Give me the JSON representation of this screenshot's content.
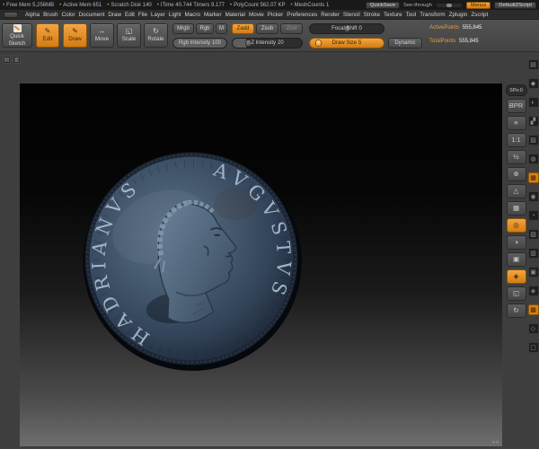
{
  "statusbar": {
    "stats": [
      "Free Mem 5,256MB",
      "Active Mem 651",
      "Scratch Disk 140",
      "ITime 40.744  Timers 9.177",
      "PolyCount 562.07 KP",
      "MeshCounts 1"
    ],
    "quicksave": "QuickSave",
    "see_through": "See-through",
    "menus": "Menus",
    "zscript": "DefaultZScript"
  },
  "menubar": {
    "items": [
      "Alpha",
      "Brush",
      "Color",
      "Document",
      "Draw",
      "Edit",
      "File",
      "Layer",
      "Light",
      "Macro",
      "Marker",
      "Material",
      "Movie",
      "Picker",
      "Preferences",
      "Render",
      "Stencil",
      "Stroke",
      "Texture",
      "Tool",
      "Transform",
      "Zplugin",
      "Zscript"
    ]
  },
  "shelf": {
    "quick_sketch": "Quick Sketch",
    "edit": "Edit",
    "draw": "Draw",
    "move": "Move",
    "scale": "Scale",
    "rotate": "Rotate",
    "icons": {
      "edit": "✎",
      "draw": "✎",
      "move": "↔",
      "scale": "◱",
      "rotate": "↻"
    },
    "mrgb": "Mrgb",
    "rgb": "Rgb",
    "m": "M",
    "zadd": "Zadd",
    "zsub": "Zsub",
    "zcut": "Zcut",
    "rgb_intensity": {
      "label": "Rgb Intensity",
      "value": "100"
    },
    "z_intensity": {
      "label": "Z Intensity",
      "value": "20"
    },
    "focal_shift": {
      "label": "Focal Shift",
      "value": "0"
    },
    "draw_size": {
      "label": "Draw Size",
      "value": "5"
    },
    "dynamic": "Dynamic",
    "active_points": {
      "label": "ActivePoints",
      "value": "555,845"
    },
    "total_points": {
      "label": "TotalPoints",
      "value": "555,845"
    }
  },
  "right_shelf": {
    "spix": {
      "label": "SPix",
      "value": "0"
    },
    "buttons": [
      {
        "name": "bpr-button",
        "glyph": "BPR"
      },
      {
        "name": "scroll-button",
        "glyph": "≡"
      },
      {
        "name": "actual-size-button",
        "glyph": "1:1"
      },
      {
        "name": "aahalf-button",
        "glyph": "½"
      },
      {
        "name": "zoom-button",
        "glyph": "⊕"
      },
      {
        "name": "persp-button",
        "glyph": "△"
      },
      {
        "name": "floor-button",
        "glyph": "▦"
      },
      {
        "name": "local-button",
        "glyph": "◎",
        "accent": true
      },
      {
        "name": "lsym-button",
        "glyph": "◑"
      },
      {
        "name": "frame-button",
        "glyph": "▣"
      },
      {
        "name": "move-3d-button",
        "glyph": "◈",
        "accent": true
      },
      {
        "name": "scale-3d-button",
        "glyph": "◱"
      },
      {
        "name": "rotate-3d-button",
        "glyph": "↻"
      }
    ]
  },
  "right_tray": {
    "icons": [
      {
        "glyph": "▤"
      },
      {
        "glyph": "◆"
      },
      {
        "glyph": "◐"
      },
      {
        "glyph": "▞"
      },
      {
        "glyph": "▨"
      },
      {
        "glyph": "◍"
      },
      {
        "glyph": "▦",
        "accent": true
      },
      {
        "glyph": "◉"
      },
      {
        "glyph": "◔"
      },
      {
        "glyph": "▧"
      },
      {
        "glyph": "▥"
      },
      {
        "glyph": "▣"
      },
      {
        "glyph": "◈"
      },
      {
        "glyph": "▩",
        "accent": true
      },
      {
        "glyph": "◇"
      },
      {
        "glyph": "▢"
      }
    ]
  },
  "left_tray": {
    "icons": [
      {
        "glyph": "▤"
      },
      {
        "glyph": "▥"
      }
    ]
  },
  "canvas": {
    "coin": {
      "legend_left": "HADRIANVS",
      "legend_right": "AVGVSTVS"
    },
    "nav": {
      "left": "◂",
      "right": "▸"
    }
  }
}
